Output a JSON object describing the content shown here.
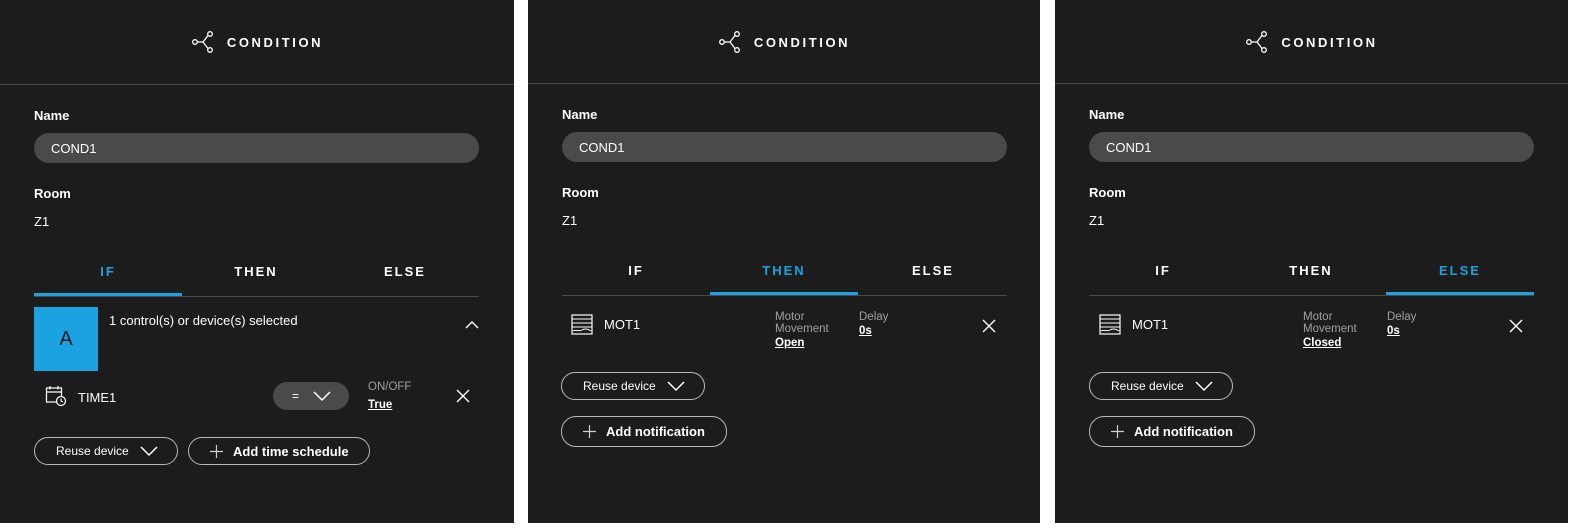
{
  "colors": {
    "accent": "#1aa3e0",
    "panel": "#1c1c1c",
    "field": "#4a4a4a"
  },
  "panels": [
    {
      "header": {
        "icon": "share-nodes-icon",
        "title": "CONDITION"
      },
      "name_label": "Name",
      "name_value": "COND1",
      "room_label": "Room",
      "room_value": "Z1",
      "tabs": [
        "IF",
        "THEN",
        "ELSE"
      ],
      "active_tab": "IF",
      "selection": {
        "avatar": "A",
        "text": "1 control(s) or device(s) selected"
      },
      "device": {
        "icon": "calendar-clock-icon",
        "name": "TIME1",
        "operator": "=",
        "prop_label": "ON/OFF",
        "prop_value": "True"
      },
      "buttons": {
        "reuse": "Reuse device",
        "add": "Add time schedule"
      }
    },
    {
      "header": {
        "icon": "share-nodes-icon",
        "title": "CONDITION"
      },
      "name_label": "Name",
      "name_value": "COND1",
      "room_label": "Room",
      "room_value": "Z1",
      "tabs": [
        "IF",
        "THEN",
        "ELSE"
      ],
      "active_tab": "THEN",
      "device": {
        "icon": "blind-icon",
        "name": "MOT1",
        "prop_label_1": "Motor",
        "prop_label_2": "Movement",
        "prop_value": "Open",
        "delay_label": "Delay",
        "delay_value": "0s"
      },
      "buttons": {
        "reuse": "Reuse device",
        "add": "Add notification"
      }
    },
    {
      "header": {
        "icon": "share-nodes-icon",
        "title": "CONDITION"
      },
      "name_label": "Name",
      "name_value": "COND1",
      "room_label": "Room",
      "room_value": "Z1",
      "tabs": [
        "IF",
        "THEN",
        "ELSE"
      ],
      "active_tab": "ELSE",
      "device": {
        "icon": "blind-icon",
        "name": "MOT1",
        "prop_label_1": "Motor",
        "prop_label_2": "Movement",
        "prop_value": "Closed",
        "delay_label": "Delay",
        "delay_value": "0s"
      },
      "buttons": {
        "reuse": "Reuse device",
        "add": "Add notification"
      }
    }
  ]
}
